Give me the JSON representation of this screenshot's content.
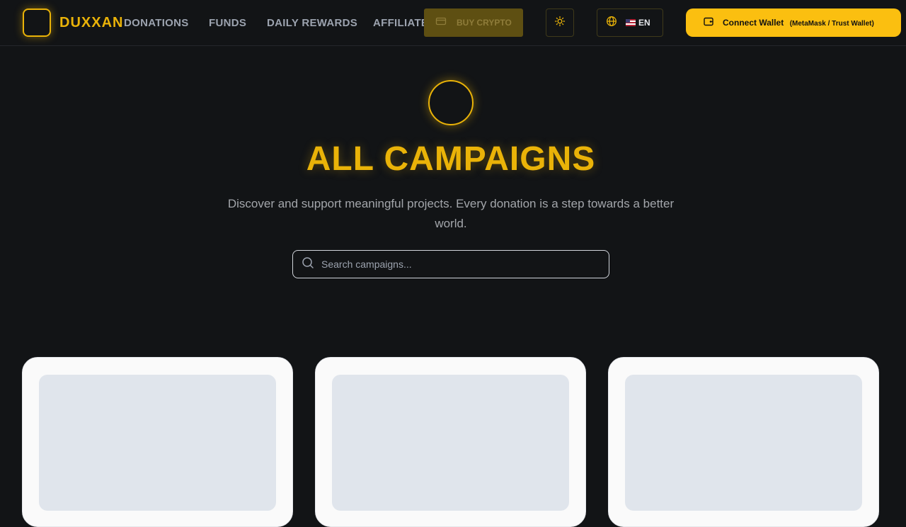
{
  "brand": {
    "name": "DUXXAN",
    "accent": "#eab308"
  },
  "nav": {
    "items": [
      {
        "label": "DONATIONS"
      },
      {
        "label": "FUNDS"
      },
      {
        "label": "DAILY REWARDS"
      },
      {
        "label": "AFFILIATE"
      }
    ]
  },
  "header": {
    "buy_crypto_label": "BUY CRYPTO",
    "language_label": "EN",
    "language_flag": "us-flag",
    "wallet_label": "Connect Wallet",
    "wallet_sub": "(MetaMask / Trust Wallet)",
    "wallet_color": "#fbbf10"
  },
  "hero": {
    "title": "ALL CAMPAIGNS",
    "description": "Discover and support meaningful projects. Every donation is a step towards a better world."
  },
  "search": {
    "placeholder": "Search campaigns..."
  },
  "cards": [
    {
      "state": "loading"
    },
    {
      "state": "loading"
    },
    {
      "state": "loading"
    }
  ]
}
